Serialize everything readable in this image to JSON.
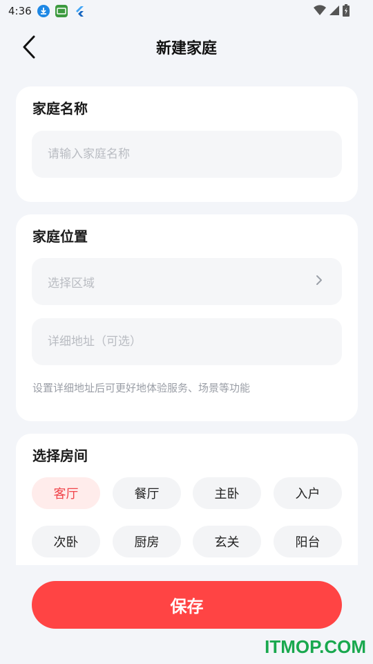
{
  "status_bar": {
    "time": "4:36",
    "notifications": [
      "download-icon",
      "tv-icon",
      "flutter-icon"
    ],
    "right_icons": [
      "wifi-icon",
      "signal-icon",
      "battery-icon"
    ]
  },
  "header": {
    "title": "新建家庭"
  },
  "family_name": {
    "title": "家庭名称",
    "placeholder": "请输入家庭名称"
  },
  "family_location": {
    "title": "家庭位置",
    "region_placeholder": "选择区域",
    "address_placeholder": "详细地址（可选）",
    "hint": "设置详细地址后可更好地体验服务、场景等功能"
  },
  "rooms": {
    "title": "选择房间",
    "items": [
      {
        "label": "客厅",
        "selected": true
      },
      {
        "label": "餐厅",
        "selected": false
      },
      {
        "label": "主卧",
        "selected": false
      },
      {
        "label": "入户",
        "selected": false
      },
      {
        "label": "次卧",
        "selected": false
      },
      {
        "label": "厨房",
        "selected": false
      },
      {
        "label": "玄关",
        "selected": false
      },
      {
        "label": "阳台",
        "selected": false
      }
    ]
  },
  "actions": {
    "save_label": "保存"
  },
  "watermark": "ITMOP.COM",
  "colors": {
    "accent": "#ff4444",
    "selected_chip_bg": "#ffeceb",
    "selected_chip_text": "#f0444a",
    "background": "#f3f5f9"
  }
}
